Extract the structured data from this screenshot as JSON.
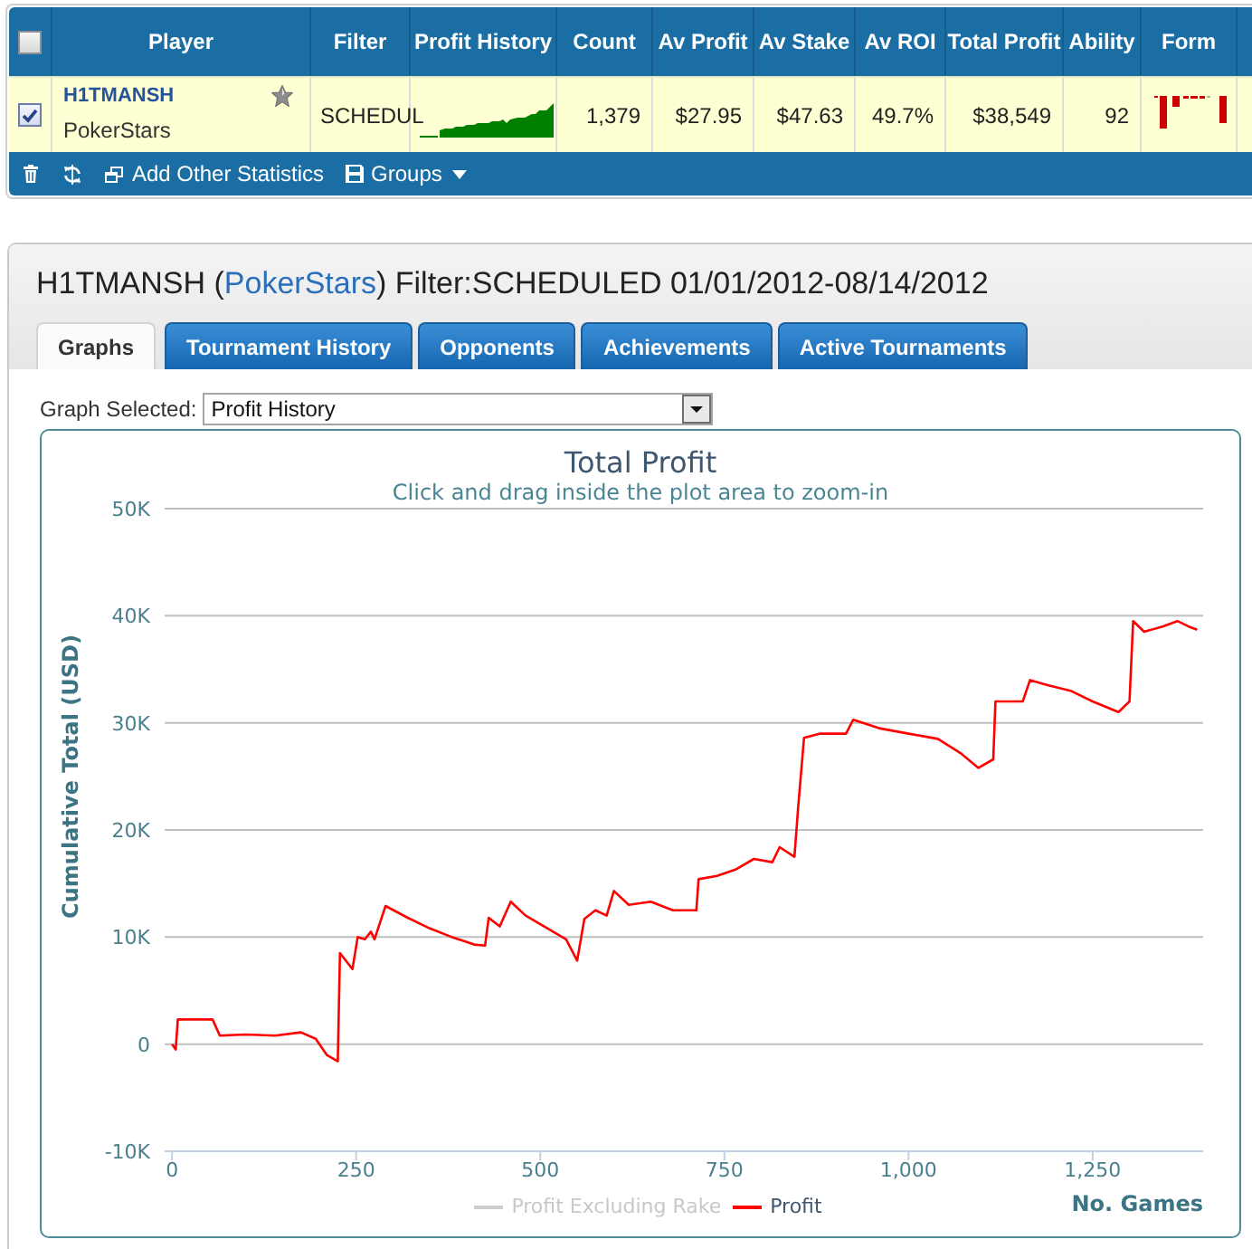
{
  "stats_table": {
    "select_all_checked": false,
    "columns": [
      "Player",
      "Filter",
      "Profit History",
      "Count",
      "Av Profit",
      "Av Stake",
      "Av ROI",
      "Total Profit",
      "Ability",
      "Form"
    ],
    "rows": [
      {
        "checked": true,
        "player": "H1TMANSH",
        "site": "PokerStars",
        "starred": false,
        "filter": "SCHEDUL",
        "count": "1,379",
        "av_profit": "$27.95",
        "av_stake": "$47.63",
        "av_roi": "49.7%",
        "total_profit": "$38,549",
        "ability": "92"
      }
    ],
    "toolbar": {
      "add_statistics": "Add Other Statistics",
      "groups": "Groups"
    }
  },
  "player_panel": {
    "title": {
      "lead": "H1TMANSH (",
      "link": "PokerStars",
      "tail": ") Filter:SCHEDULED 01/01/2012-08/14/2012"
    },
    "tabs": [
      {
        "label": "Graphs",
        "selected": true
      },
      {
        "label": "Tournament History",
        "selected": false
      },
      {
        "label": "Opponents",
        "selected": false
      },
      {
        "label": "Achievements",
        "selected": false
      },
      {
        "label": "Active Tournaments",
        "selected": false
      }
    ],
    "graph_select": {
      "label": "Graph Selected:",
      "value": "Profit History"
    },
    "graph": {
      "subtitle": "Click and drag inside the plot area to zoom-in",
      "legend": [
        {
          "visible": false
        },
        {
          "visible": true
        }
      ],
      "chart_data": {
        "type": "line",
        "title": "Total Profit",
        "xlabel": "No. Games",
        "ylabel": "Cumulative Total (USD)",
        "grid": true,
        "x": [
          0,
          5,
          8,
          55,
          65,
          100,
          140,
          175,
          195,
          210,
          225,
          228,
          245,
          252,
          262,
          270,
          275,
          290,
          320,
          350,
          380,
          410,
          425,
          430,
          445,
          460,
          480,
          510,
          535,
          550,
          560,
          575,
          590,
          600,
          620,
          650,
          680,
          712,
          715,
          740,
          765,
          790,
          815,
          825,
          845,
          850,
          858,
          880,
          915,
          925,
          960,
          1000,
          1040,
          1070,
          1095,
          1115,
          1118,
          1155,
          1165,
          1190,
          1220,
          1250,
          1285,
          1300,
          1305,
          1320,
          1345,
          1365,
          1380,
          1392
        ],
        "series": [
          {
            "name": "Profit Excluding Rake",
            "color": "#cccccc",
            "values": [
              null,
              null,
              null,
              null,
              null,
              null,
              null,
              null,
              null,
              null,
              null,
              null,
              null,
              null,
              null,
              null,
              null,
              null,
              null,
              null,
              null,
              null,
              null,
              null,
              null,
              null,
              null,
              null,
              null,
              null,
              null,
              null,
              null,
              null,
              null,
              null,
              null,
              null,
              null,
              null,
              null,
              null,
              null,
              null,
              null,
              null,
              null,
              null,
              null,
              null,
              null,
              null,
              null,
              null,
              null,
              null,
              null,
              null,
              null,
              null,
              null,
              null,
              null,
              null,
              null,
              null,
              null,
              null,
              null,
              null
            ]
          },
          {
            "name": "Profit",
            "color": "#ff0000",
            "values": [
              0,
              -500,
              2300,
              2300,
              800,
              900,
              800,
              1100,
              500,
              -1000,
              -1600,
              8500,
              7000,
              10000,
              9800,
              10500,
              9800,
              12900,
              11800,
              10800,
              10000,
              9300,
              9200,
              11800,
              11000,
              13300,
              12000,
              10800,
              9800,
              7800,
              11700,
              12500,
              12000,
              14300,
              13000,
              13300,
              12500,
              12500,
              15400,
              15700,
              16300,
              17300,
              17000,
              18400,
              17500,
              22000,
              28600,
              29000,
              29000,
              30300,
              29500,
              29000,
              28500,
              27200,
              25800,
              26600,
              32000,
              32000,
              34000,
              33500,
              33000,
              32000,
              31000,
              32000,
              39500,
              38500,
              39000,
              39500,
              39000,
              38700
            ]
          }
        ],
        "xlim": [
          -10,
          1400
        ],
        "ylim": [
          -10000,
          50000
        ],
        "xticks": [
          0,
          250,
          500,
          750,
          {
            "value": 1000,
            "label": "1,000"
          },
          {
            "value": 1250,
            "label": "1,250"
          }
        ],
        "yticks": [
          {
            "value": -10000,
            "label": "-10K"
          },
          {
            "value": 0,
            "label": "0"
          },
          {
            "value": 10000,
            "label": "10K"
          },
          {
            "value": 20000,
            "label": "20K"
          },
          {
            "value": 30000,
            "label": "30K"
          },
          {
            "value": 40000,
            "label": "40K"
          },
          {
            "value": 50000,
            "label": "50K"
          }
        ]
      }
    }
  }
}
